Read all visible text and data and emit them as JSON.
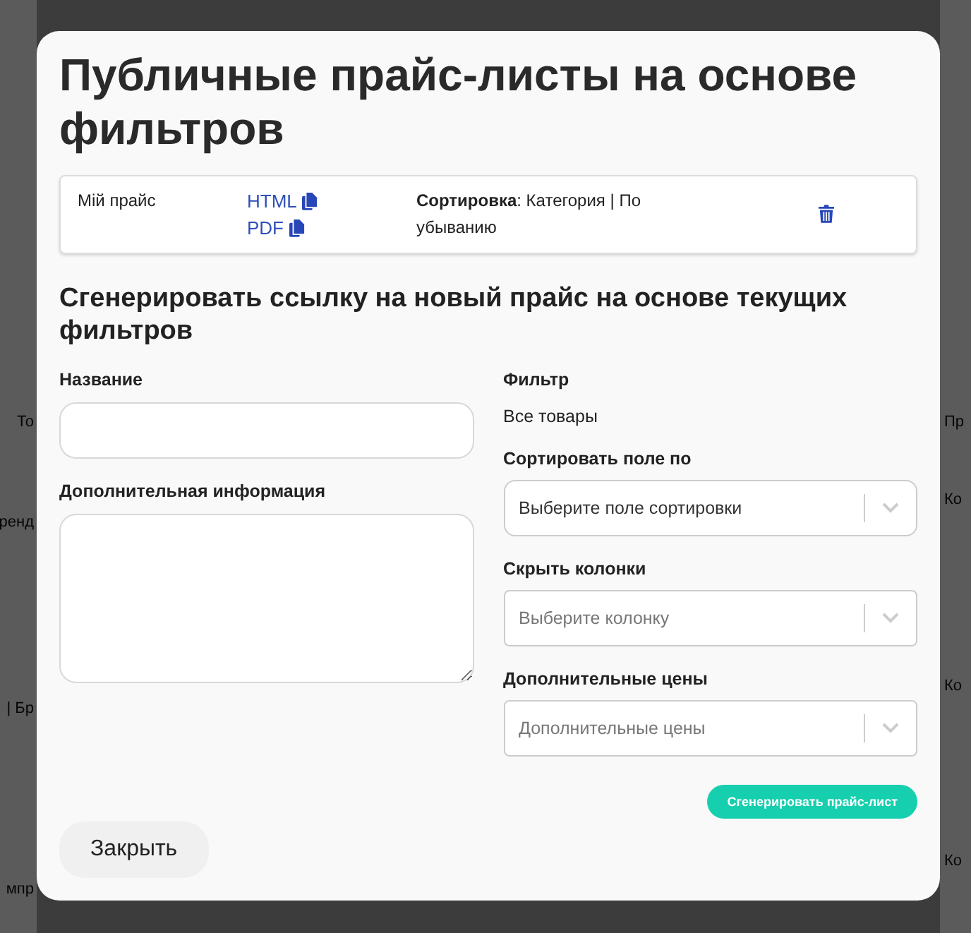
{
  "background": {
    "left_fragments": [
      "То",
      "ренд",
      "| Бр",
      "мпр"
    ],
    "right_fragments": [
      "Пр",
      "Ко",
      "Ко",
      "Ко"
    ]
  },
  "modal": {
    "title": "Публичные прайс-листы на основе фильтров",
    "price_lists": [
      {
        "name": "Мій прайс",
        "links": [
          "HTML",
          "PDF"
        ],
        "sort_label": "Сортировка",
        "sort_value": ": Категория | По убыванию"
      }
    ],
    "section_title": "Сгенерировать ссылку на новый прайс на основе текущих фильтров",
    "name_field": {
      "label": "Название"
    },
    "info_field": {
      "label": "Дополнительная информация"
    },
    "filter": {
      "label": "Фильтр",
      "value": "Все товары"
    },
    "selects": [
      {
        "label": "Сортировать поле по",
        "placeholder": "Выберите поле сортировки",
        "disabled": false
      },
      {
        "label": "Скрыть колонки",
        "placeholder": "Выберите колонку",
        "disabled": true
      },
      {
        "label": "Дополнительные цены",
        "placeholder": "Дополнительные цены",
        "disabled": true
      }
    ],
    "generate_button": "Сгенерировать прайс-лист",
    "close_button": "Закрыть"
  }
}
